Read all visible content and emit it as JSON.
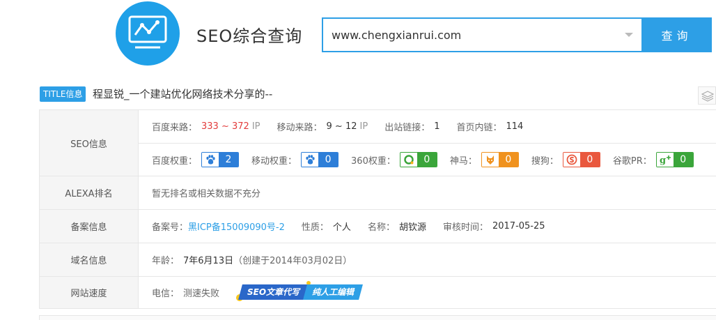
{
  "header": {
    "site_title": "SEO综合查询",
    "search_value": "www.chengxianrui.com",
    "search_button": "查询"
  },
  "title_line": {
    "badge": "TITLE信息",
    "text": "程显锐_一个建站优化网络技术分享的--"
  },
  "seo_info": {
    "label": "SEO信息",
    "baidu_traffic_key": "百度来路：",
    "baidu_traffic_value": "333 ~ 372",
    "baidu_traffic_unit": "IP",
    "mobile_traffic_key": "移动来路：",
    "mobile_traffic_value": "9 ~ 12",
    "mobile_traffic_unit": "IP",
    "outbound_key": "出站链接：",
    "outbound_value": "1",
    "homepage_links_key": "首页内链：",
    "homepage_links_value": "114",
    "weights": [
      {
        "key": "百度权重：",
        "value": "2",
        "color": "#2d7ed8",
        "icon": "baidu-paw-icon"
      },
      {
        "key": "移动权重：",
        "value": "0",
        "color": "#2d7ed8",
        "icon": "mobile-paw-icon"
      },
      {
        "key": "360权重：",
        "value": "0",
        "color": "#3aa53a",
        "icon": "360-icon"
      },
      {
        "key": "神马：",
        "value": "0",
        "color": "#f0921e",
        "icon": "shenma-icon"
      },
      {
        "key": "搜狗：",
        "value": "0",
        "color": "#e9583e",
        "icon": "sogou-icon"
      },
      {
        "key": "谷歌PR：",
        "value": "0",
        "color": "#3aa53a",
        "icon": "google-plus-icon"
      }
    ]
  },
  "alexa": {
    "label": "ALEXA排名",
    "text": "暂无排名或相关数据不充分"
  },
  "icp": {
    "label": "备案信息",
    "number_key": "备案号：",
    "number_value": "黑ICP备15009090号-2",
    "nature_key": "性质：",
    "nature_value": "个人",
    "name_key": "名称：",
    "name_value": "胡钦源",
    "review_key": "审核时间：",
    "review_value": "2017-05-25"
  },
  "domain": {
    "label": "域名信息",
    "age_key": "年龄：",
    "age_value": "7年6月13日",
    "created": "（创建于2014年03月02日）"
  },
  "speed": {
    "label": "网站速度",
    "telecom_key": "电信：",
    "telecom_value": "测速失败",
    "ad_left": "SEO文章代写",
    "ad_right": "纯人工编辑"
  }
}
